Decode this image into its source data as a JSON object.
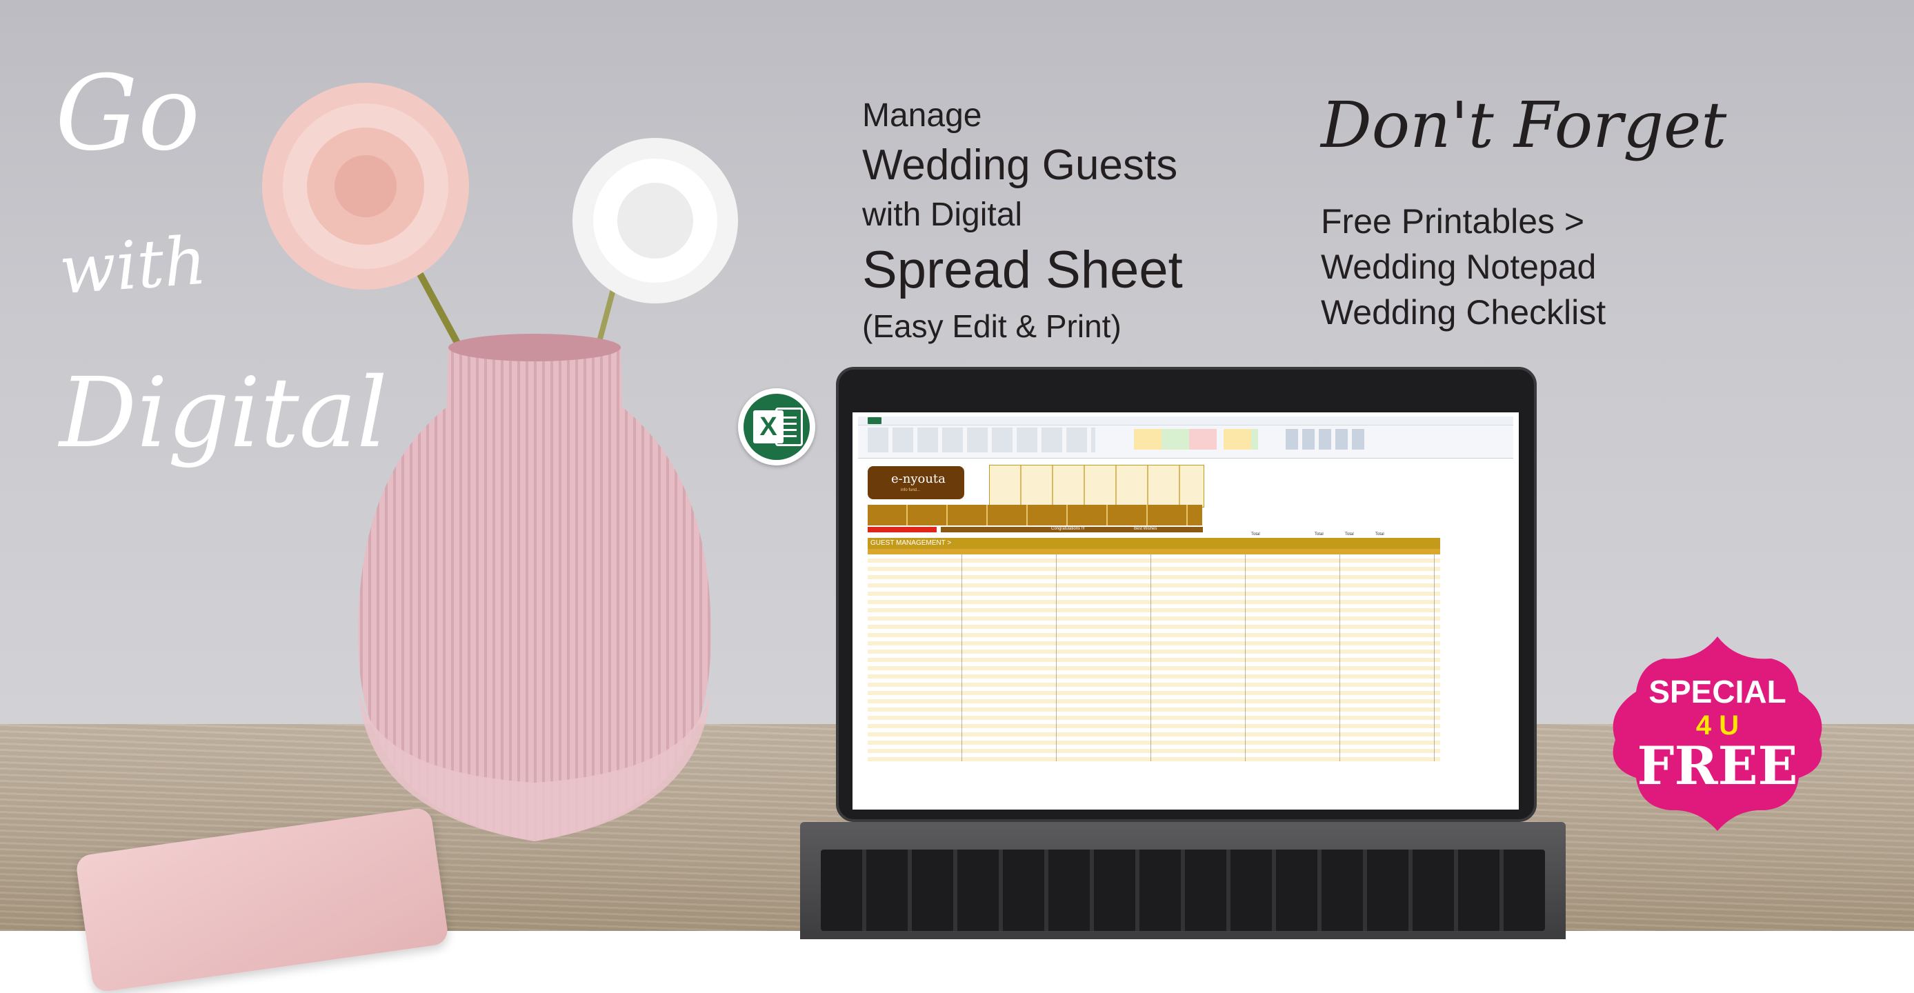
{
  "left_script": {
    "line1": "Go",
    "line2": "with",
    "line3": "Digital"
  },
  "headline": {
    "line1": "Manage",
    "line2": "Wedding Guests",
    "line3": "with Digital",
    "line4": "Spread Sheet",
    "line5": "(Easy Edit & Print)"
  },
  "reminder": {
    "title": "Don't Forget",
    "line1": "Free Printables >",
    "line2": "Wedding Notepad",
    "line3": "Wedding Checklist"
  },
  "badge": {
    "line1": "SPECIAL",
    "line2": "4 U",
    "line3": "FREE",
    "color": "#e0197d",
    "accent": "#ffe600"
  },
  "excel_icon": {
    "icon": "excel-icon",
    "letter": "X",
    "color": "#1d7044"
  },
  "spreadsheet": {
    "logo_text": "e-nyouta",
    "logo_sub": "info fund...",
    "section_title": "GUEST MANAGEMENT >",
    "congrats": "Congratulations !!!",
    "best_wishes": "Best Wishes",
    "totals": [
      "Total",
      "Total",
      "Total",
      "Total"
    ]
  }
}
